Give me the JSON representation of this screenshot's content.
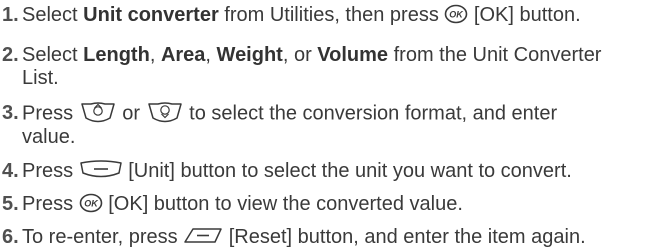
{
  "steps": [
    {
      "number": "1.",
      "t1": "Select ",
      "b1": "Unit converter",
      "t2": " from Utilities, then press ",
      "icon": "ok-key-icon",
      "t3": " [OK] button."
    },
    {
      "number": "2.",
      "t1": "Select ",
      "b1": "Length",
      "t2": ", ",
      "b2": "Area",
      "t3": ", ",
      "b3": "Weight",
      "t4": ", or ",
      "b4": "Volume",
      "t5": " from the Unit Converter",
      "t6": "List."
    },
    {
      "number": "3.",
      "t1": "Press ",
      "icon1": "nav-up-key-icon",
      "t2": " or ",
      "icon2": "nav-down-key-icon",
      "t3": " to select the conversion format, and enter",
      "t4": "value."
    },
    {
      "number": "4.",
      "t1": "Press ",
      "icon": "left-soft-key-icon",
      "t2": " [Unit] button to select the unit you want to convert."
    },
    {
      "number": "5.",
      "t1": "Press ",
      "icon": "ok-key-icon",
      "t2": " [OK] button to view the converted value."
    },
    {
      "number": "6.",
      "t1": "To re-enter, press ",
      "icon": "right-soft-key-icon",
      "t2": " [Reset] button, and enter the item again."
    }
  ]
}
